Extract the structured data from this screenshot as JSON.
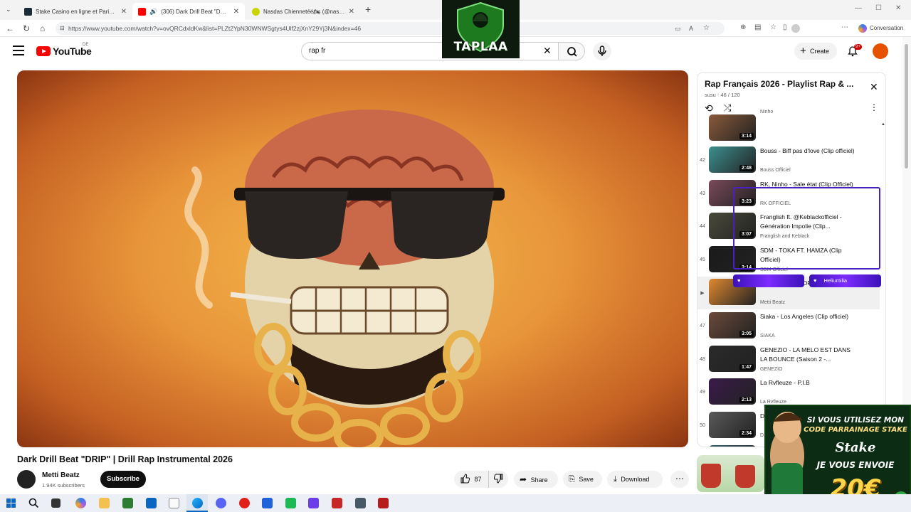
{
  "browser": {
    "tabs": [
      {
        "label": "Stake Casino en ligne et Paris Spor",
        "favicon_color": "#1a2c38"
      },
      {
        "label": "(306) Dark Drill Beat \"DRIP\" | D",
        "favicon_color": "#ff0000",
        "active": true
      },
      {
        "label": "Nasdas Chiennetéé🏍 (@naslchien",
        "favicon_color": "#c9d400"
      }
    ],
    "new_tab": "+",
    "url": "https://www.youtube.com/watch?v=ovQRCdxldKw&list=PLZt2YpN30WNWSgtys4Ulf2zjXnY29Yj3N&index=46",
    "conversation_label": "Conversation"
  },
  "youtube": {
    "logo_text": "YouTube",
    "country_code": "DE",
    "search_query": "rap fr",
    "create_label": "Create",
    "notifications_badge": "9+"
  },
  "video": {
    "title": "Dark Drill Beat \"DRIP\" | Drill Rap Instrumental 2026",
    "channel": "Metti Beatz",
    "subscribers": "1.94K subscribers",
    "subscribe_label": "Subscribe",
    "likes": "87",
    "share_label": "Share",
    "save_label": "Save",
    "download_label": "Download"
  },
  "playlist": {
    "title": "Rap Français 2026 - Playlist Rap & ...",
    "subtitle": "susu - 46 / 120",
    "items": [
      {
        "index": "",
        "title": "",
        "channel": "Ninho",
        "duration": "3:14",
        "thumb": "#8a5a3a"
      },
      {
        "index": "42",
        "title": "Bouss - Biff pas d'love (Clip officiel)",
        "channel": "Bouss Officiel",
        "duration": "2:48",
        "thumb": "#3d8f8f"
      },
      {
        "index": "43",
        "title": "RK, Ninho - Sale état (Clip Officiel)",
        "channel": "RK OFFICIEL",
        "duration": "3:23",
        "thumb": "#7a4a5a"
      },
      {
        "index": "44",
        "title": "Franglish ft. @Keblackofficiel - Génération Impolie (Clip...",
        "channel": "Franglish and Keblack",
        "duration": "3:07",
        "thumb": "#4a4a3a"
      },
      {
        "index": "45",
        "title": "SDM - TOKA FT. HAMZA (Clip Officiel)",
        "channel": "SDM Officiel",
        "duration": "3:14",
        "thumb": "#1a1a1a"
      },
      {
        "index": "▶",
        "title": "Dark Drill Beat \"DRIP\" | Drill Rap",
        "channel": "Metti Beatz",
        "duration": "",
        "thumb": "#e0892f"
      },
      {
        "index": "47",
        "title": "Siaka - Los Angeles (Clip officiel)",
        "channel": "SIAKA",
        "duration": "3:05",
        "thumb": "#6a4a3a"
      },
      {
        "index": "48",
        "title": "GENEZIO - LA MELO EST DANS LA BOUNCE (Saison 2 -...",
        "channel": "GENEZIO",
        "duration": "1:47",
        "thumb": "#2a2a2a"
      },
      {
        "index": "49",
        "title": "La Rvfleuze - P.I.B",
        "channel": "La Rvfleuze",
        "duration": "2:13",
        "thumb": "#3a1a4a"
      },
      {
        "index": "50",
        "title": "Djadja & Dinaz - Les bases [Clip O",
        "channel": "D",
        "duration": "2:34",
        "thumb": "#5a5a5a"
      },
      {
        "index": "51",
        "title": "D",
        "channel": "",
        "duration": "",
        "thumb": "#3a5a6a"
      }
    ]
  },
  "overlays": {
    "taplaa_text": "TAPLAA",
    "hearts_right_label": "Heliumilia",
    "ad_line1": "SI VOUS UTILISEZ MON",
    "ad_line2": "CODE PARRAINAGE STAKE",
    "ad_brand": "Stake",
    "ad_line3": "JE VOUS ENVOIE",
    "ad_amount": "20€"
  }
}
